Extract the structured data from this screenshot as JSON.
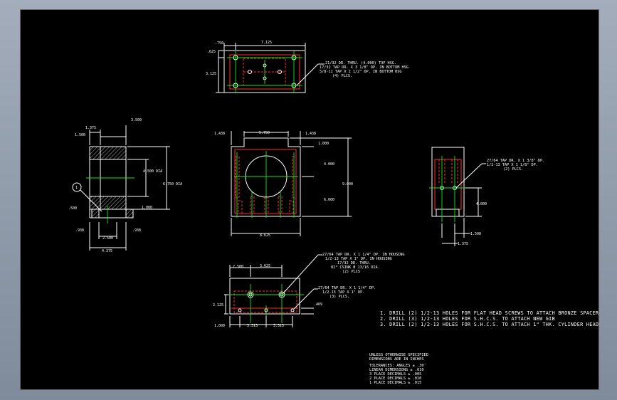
{
  "top_view": {
    "dims": {
      "left": ".750",
      "width": "7.125",
      "offset": ".625",
      "height": "3.125"
    },
    "note": [
      "21/32 DR. THRU. (4.000) TOP HSG.",
      "17/32 TAP DR. X 3 1/8\" DP. IN BOTTOM HSG",
      "5/8-11 TAP X 2 1/2\" DP. IN BOTTOM HSG",
      "(4) PLCS."
    ]
  },
  "left_view": {
    "dims": {
      "d1": "1.375",
      "d2": "3.500",
      "d3": "1.500",
      "d4": "4.500 DIA",
      "d5": "6.750 DIA",
      "d6": ".500",
      "d7": "1.000",
      "d8": ".938",
      "d9": "2.500",
      "d10": ".938",
      "d11": "4.375"
    },
    "balloon": "1"
  },
  "front_view": {
    "dims": {
      "d1": "1.438",
      "d2": "5.750",
      "d3": "1.438",
      "d4": "1.000",
      "d5": "4.000",
      "d6": "9.000",
      "d7": "6.000",
      "d8": "8.625"
    }
  },
  "right_view": {
    "note": [
      "27/64 TAP DR. X 1 3/8\" DP.",
      "1/2-13 TAP X 1 1/8\" DP.",
      "(2) PLCS."
    ],
    "dims": {
      "d1": "4.000",
      "d2": "1.500",
      "d3": "1.375"
    }
  },
  "bottom_view": {
    "note1": [
      "27/64 TAP DR. X 1 1/4\" DP. IN HOUSING",
      "1/2-13 TAP X 1\" DP. IN HOUSING",
      "17/32 DR. THRU.",
      "82° CSINK Ø 13/16 DIA.",
      "(2) PLCS"
    ],
    "note2": [
      "27/64 TAP DR. X 1 1/4\" DP.",
      "1/2-13 TAP X 1\" DP.",
      "(3) PLCS."
    ],
    "dims": {
      "d1": "2.500",
      "d2": "3.625",
      "d3": "2.125",
      "d4": ".469",
      "d5": "1.000",
      "d6": "3.313",
      "d7": "3.313"
    }
  },
  "general_notes": [
    "1. DRILL (2) 1/2-13 HOLES FOR FLAT HEAD SCREWS TO ATTACH BRONZE SPACER",
    "2. DRILL (3) 1/2-13 HOLES FOR S.H.C.S. TO ATTACH NEW GIB",
    "3. DRILL (2) 1/2-13 HOLES FOR S.H.C.S. TO ATTACH 1\" THK. CYLINDER HEAD SPACER"
  ],
  "tolerances": {
    "header": [
      "UNLESS OTHERWISE SPECIFIED",
      "DIMENSIONS ARE IN INCHES"
    ],
    "lines": [
      "TOLERANCES: ANGLES ± .30'",
      "LINEAR DIMENSIONS ± .010",
      "3 PLACE DECIMALS ± .005",
      "2 PLACE DECIMALS ± .010",
      "1 PLACE DECIMALS ± .015"
    ]
  }
}
